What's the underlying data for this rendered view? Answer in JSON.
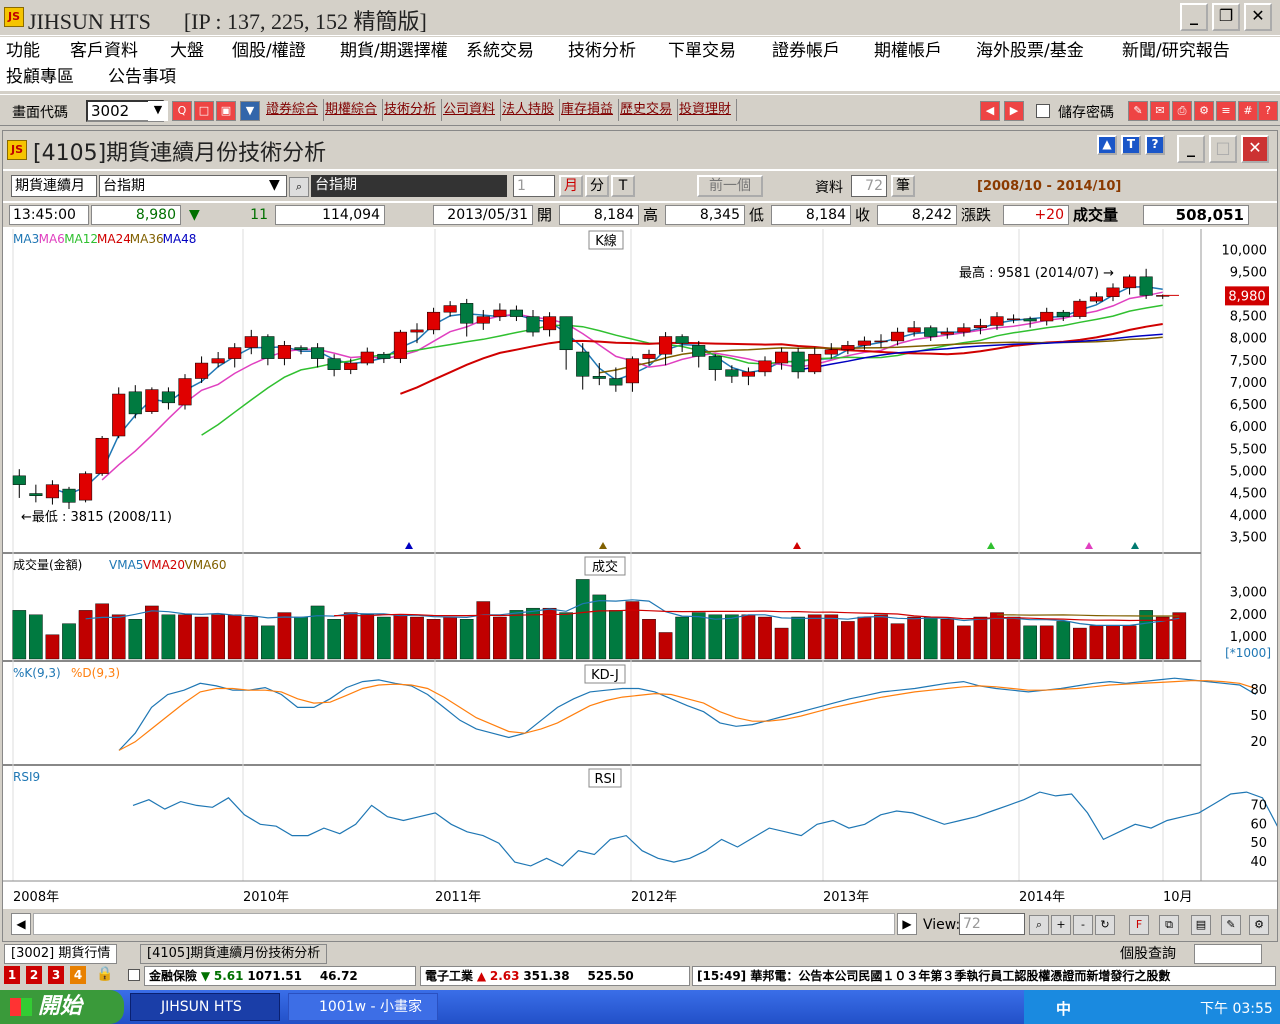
{
  "window": {
    "title": "JIHSUN HTS      [IP : 137, 225, 152 精簡版]"
  },
  "menu": {
    "row1": [
      "功能",
      "客戶資料",
      "大盤",
      "個股/權證",
      "期貨/期選擇權",
      "系統交易",
      "技術分析",
      "下單交易",
      "證券帳戶",
      "期權帳戶",
      "海外股票/基金",
      "新聞/研究報告"
    ],
    "row2": [
      "投顧專區",
      "公告事項"
    ]
  },
  "toolbar": {
    "code_label": "畫面代碼",
    "code_value": "3002",
    "links": [
      "證券綜合",
      "期權綜合",
      "技術分析",
      "公司資料",
      "法人持股",
      "庫存損益",
      "歷史交易",
      "投資理財"
    ],
    "save_pwd": "儲存密碼"
  },
  "panel": {
    "title": "[4105]期貨連續月份技術分析"
  },
  "selector": {
    "category": "期貨連續月",
    "product": "台指期",
    "product_display": "台指期",
    "count_num": "1",
    "month_btn": "月",
    "min_btn": "分",
    "t_btn": "T",
    "prev_btn": "前一個",
    "data_label": "資料",
    "data_count": "72",
    "unit": "筆",
    "range": "[2008/10 - 2014/10]"
  },
  "quote": {
    "time": "13:45:00",
    "price": "8,980",
    "change": "11",
    "volume": "114,094",
    "date": "2013/05/31",
    "open_lbl": "開",
    "open": "8,184",
    "high_lbl": "高",
    "high": "8,345",
    "low_lbl": "低",
    "low": "8,184",
    "close_lbl": "收",
    "close": "8,242",
    "chg_lbl": "漲跌",
    "chg": "+20",
    "vol_lbl": "成交量",
    "vol": "508,051"
  },
  "chart_data": {
    "type": "candlestick",
    "title": "K線",
    "legend_ma": [
      "MA3",
      "MA6",
      "MA12",
      "MA24",
      "MA36",
      "MA48"
    ],
    "ma_colors": [
      "#1f77b4",
      "#e040c0",
      "#30c030",
      "#d00000",
      "#806000",
      "#0000c0"
    ],
    "price_ticks": [
      10000,
      9500,
      9000,
      8500,
      8000,
      7500,
      7000,
      6500,
      6000,
      5500,
      5000,
      4500,
      4000,
      3500
    ],
    "current_price": "8,980",
    "annot_high": "最高 : 9581 (2014/07) →",
    "annot_low": "←最低 : 3815 (2008/11)",
    "x_labels": [
      "2008年",
      "2010年",
      "2011年",
      "2012年",
      "2013年",
      "2014年",
      "10月"
    ],
    "candles": [
      [
        4900,
        4700,
        5050,
        4400
      ],
      [
        4500,
        4450,
        4700,
        4300
      ],
      [
        4400,
        4700,
        4800,
        4250
      ],
      [
        4600,
        4300,
        4650,
        4150
      ],
      [
        4350,
        4950,
        5000,
        4300
      ],
      [
        4950,
        5750,
        5800,
        4900
      ],
      [
        5800,
        6750,
        6900,
        5750
      ],
      [
        6800,
        6300,
        6950,
        6200
      ],
      [
        6350,
        6850,
        6900,
        6300
      ],
      [
        6800,
        6550,
        6900,
        6400
      ],
      [
        6500,
        7100,
        7200,
        6400
      ],
      [
        7100,
        7450,
        7600,
        7000
      ],
      [
        7450,
        7550,
        7700,
        7350
      ],
      [
        7550,
        7800,
        7900,
        7350
      ],
      [
        7800,
        8050,
        8200,
        7650
      ],
      [
        8050,
        7550,
        8100,
        7400
      ],
      [
        7550,
        7850,
        7950,
        7400
      ],
      [
        7800,
        7750,
        7850,
        7650
      ],
      [
        7800,
        7550,
        7900,
        7350
      ],
      [
        7550,
        7300,
        7650,
        7150
      ],
      [
        7300,
        7450,
        7550,
        7200
      ],
      [
        7450,
        7700,
        7800,
        7400
      ],
      [
        7650,
        7550,
        7700,
        7450
      ],
      [
        7550,
        8150,
        8200,
        7450
      ],
      [
        8150,
        8200,
        8350,
        7900
      ],
      [
        8200,
        8600,
        8700,
        8100
      ],
      [
        8600,
        8750,
        8850,
        8500
      ],
      [
        8800,
        8350,
        8900,
        8050
      ],
      [
        8350,
        8500,
        8650,
        8200
      ],
      [
        8500,
        8650,
        8800,
        8400
      ],
      [
        8650,
        8500,
        8750,
        8400
      ],
      [
        8500,
        8150,
        8650,
        8050
      ],
      [
        8200,
        8500,
        8600,
        8050
      ],
      [
        8500,
        7750,
        8500,
        7300
      ],
      [
        7700,
        7150,
        7900,
        6850
      ],
      [
        7150,
        7100,
        7450,
        6950
      ],
      [
        7100,
        6950,
        7350,
        6800
      ],
      [
        7000,
        7550,
        7600,
        6800
      ],
      [
        7550,
        7650,
        7750,
        7400
      ],
      [
        7650,
        8050,
        8150,
        7400
      ],
      [
        8050,
        7900,
        8100,
        7700
      ],
      [
        7850,
        7600,
        7950,
        7350
      ],
      [
        7600,
        7300,
        7650,
        7050
      ],
      [
        7300,
        7150,
        7400,
        7000
      ],
      [
        7150,
        7250,
        7350,
        6950
      ],
      [
        7250,
        7500,
        7600,
        7150
      ],
      [
        7450,
        7700,
        7800,
        7300
      ],
      [
        7700,
        7250,
        7800,
        7100
      ],
      [
        7250,
        7650,
        7800,
        7200
      ],
      [
        7650,
        7750,
        7900,
        7550
      ],
      [
        7750,
        7850,
        7950,
        7650
      ],
      [
        7850,
        7950,
        8050,
        7750
      ],
      [
        7950,
        7950,
        8100,
        7800
      ],
      [
        7950,
        8150,
        8250,
        7850
      ],
      [
        8150,
        8250,
        8400,
        8050
      ],
      [
        8250,
        8050,
        8300,
        7950
      ],
      [
        8100,
        8150,
        8250,
        8000
      ],
      [
        8150,
        8250,
        8350,
        8050
      ],
      [
        8250,
        8300,
        8450,
        8100
      ],
      [
        8300,
        8500,
        8600,
        8200
      ],
      [
        8450,
        8450,
        8550,
        8350
      ],
      [
        8450,
        8400,
        8500,
        8250
      ],
      [
        8400,
        8600,
        8700,
        8300
      ],
      [
        8600,
        8500,
        8650,
        8400
      ],
      [
        8500,
        8850,
        8900,
        8450
      ],
      [
        8850,
        8950,
        9050,
        8800
      ],
      [
        8950,
        9150,
        9250,
        8850
      ],
      [
        9150,
        9400,
        9450,
        9000
      ],
      [
        9400,
        8980,
        9581,
        8900
      ],
      [
        8980,
        8980,
        9000,
        8900
      ]
    ],
    "volume_legend": "成交量(金額)",
    "volume_ma": [
      "VMA5",
      "VMA20",
      "VMA60"
    ],
    "volume_title": "成交",
    "volume_ticks": [
      3000,
      2000,
      1000
    ],
    "volume_unit": "[*1000]",
    "volumes": [
      2200,
      2000,
      1100,
      1600,
      2200,
      2500,
      2000,
      1800,
      2400,
      2000,
      2000,
      1900,
      2000,
      2000,
      1900,
      1500,
      2100,
      1900,
      2400,
      1800,
      2100,
      2000,
      1900,
      2000,
      1900,
      1800,
      1900,
      1800,
      2600,
      1900,
      2200,
      2300,
      2300,
      2100,
      3600,
      2900,
      2200,
      2600,
      1800,
      1200,
      1900,
      2100,
      2000,
      2000,
      2000,
      1900,
      1400,
      1900,
      2000,
      2000,
      1700,
      1900,
      2000,
      1600,
      1900,
      1900,
      1800,
      1500,
      1900,
      2100,
      1900,
      1500,
      1500,
      1700,
      1400,
      1500,
      1500,
      1500,
      2200,
      1900,
      2100
    ],
    "kd_legend": [
      "%K(9,3)",
      "%D(9,3)"
    ],
    "kd_title": "KD-J",
    "kd_ticks": [
      80,
      50,
      20
    ],
    "k_values": [
      10,
      30,
      60,
      75,
      80,
      88,
      85,
      80,
      80,
      83,
      75,
      60,
      60,
      70,
      83,
      90,
      92,
      88,
      85,
      75,
      60,
      45,
      35,
      30,
      25,
      30,
      45,
      60,
      70,
      78,
      80,
      82,
      82,
      78,
      70,
      62,
      55,
      42,
      38,
      40,
      45,
      50,
      55,
      60,
      65,
      70,
      74,
      78,
      80,
      82,
      85,
      88,
      90,
      85,
      82,
      80,
      78,
      80,
      82,
      85,
      88,
      90,
      88,
      90,
      92,
      94,
      92,
      90,
      88,
      86,
      75
    ],
    "d_values": [
      10,
      20,
      35,
      50,
      65,
      78,
      82,
      82,
      80,
      80,
      78,
      70,
      65,
      66,
      74,
      82,
      86,
      87,
      86,
      82,
      72,
      60,
      48,
      40,
      32,
      30,
      35,
      42,
      52,
      62,
      68,
      72,
      74,
      76,
      75,
      70,
      65,
      55,
      48,
      44,
      44,
      46,
      50,
      55,
      60,
      64,
      68,
      72,
      75,
      78,
      80,
      82,
      84,
      85,
      84,
      82,
      80,
      80,
      81,
      82,
      84,
      86,
      87,
      88,
      89,
      90,
      91,
      91,
      90,
      88,
      82
    ],
    "rsi_legend": "RSI9",
    "rsi_title": "RSI",
    "rsi_ticks": [
      70,
      60,
      50,
      40
    ],
    "rsi_values": [
      70,
      73,
      68,
      72,
      70,
      69,
      74,
      65,
      60,
      59,
      54,
      54,
      58,
      55,
      60,
      70,
      64,
      62,
      64,
      66,
      60,
      56,
      54,
      50,
      40,
      38,
      42,
      38,
      46,
      44,
      52,
      54,
      46,
      42,
      40,
      42,
      46,
      52,
      48,
      53,
      58,
      56,
      54,
      60,
      62,
      58,
      60,
      65,
      67,
      66,
      63,
      60,
      62,
      64,
      67,
      70,
      73,
      77,
      75,
      76,
      66,
      52,
      56,
      60,
      58,
      62,
      64,
      66,
      71,
      76,
      77,
      74,
      58,
      57
    ],
    "x_positions": [
      0,
      1,
      2,
      3,
      4,
      5,
      6
    ]
  },
  "scroll": {
    "view_label": "View:",
    "view_value": "72"
  },
  "tabs": [
    "[3002] 期貨行情",
    "[4105]期貨連續月份技術分析"
  ],
  "right_query": "個股查詢",
  "ticker": {
    "item1_name": "金融保險",
    "item1_chg": "5.61",
    "item1_val": "1071.51",
    "item1_vol": "46.72",
    "item2_name": "電子工業",
    "item2_chg": "2.63",
    "item2_val": "351.38",
    "item2_vol": "525.50",
    "news": "[15:49] 華邦電：公告本公司民國１０３年第３季執行員工認股權憑證而新增發行之股數"
  },
  "taskbar": {
    "start": "開始",
    "app1": "JIHSUN HTS",
    "app2": "1001w - 小畫家",
    "clock": "下午 03:55"
  }
}
